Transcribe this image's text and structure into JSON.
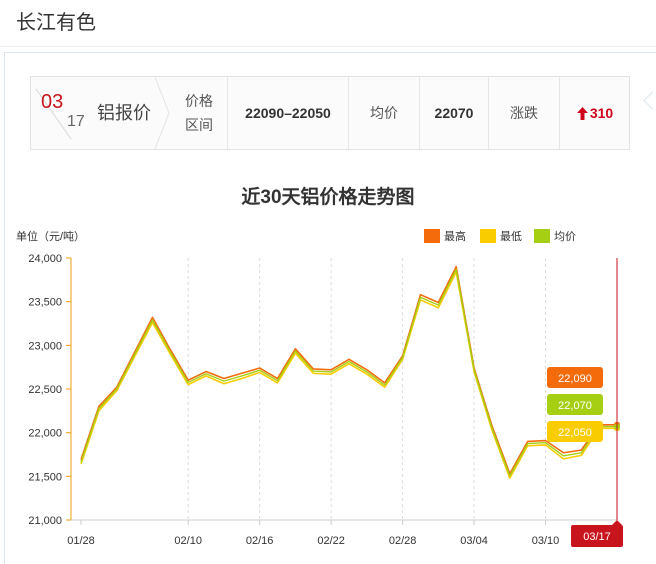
{
  "site": {
    "title": "长江有色"
  },
  "price_bar": {
    "month": "03",
    "day": "17",
    "product": "铝报价",
    "range_label_1": "价格",
    "range_label_2": "区间",
    "range_value": "22090–22050",
    "avg_label": "均价",
    "avg_value": "22070",
    "change_label": "涨跌",
    "change_value": "310",
    "change_direction": "up",
    "colors": {
      "date": "#c8151d",
      "up": "#d0021b"
    }
  },
  "chart_data": {
    "type": "line",
    "title": "近30天铝价格走势图",
    "ylabel": "单位（元/吨）",
    "xlabel": "",
    "ylim": [
      21000,
      24000
    ],
    "y_ticks": [
      "21,000",
      "21,500",
      "22,000",
      "22,500",
      "23,000",
      "23,500",
      "24,000"
    ],
    "x_tick_labels": [
      "01/28",
      "02/10",
      "02/16",
      "02/22",
      "02/28",
      "03/04",
      "03/10",
      "03/17"
    ],
    "x_tick_index": [
      0,
      6,
      10,
      14,
      18,
      22,
      26,
      30
    ],
    "grid": "vertical dashed",
    "legend": "top-right",
    "x": [
      "01/28",
      "01/29",
      "01/30",
      "01/31",
      "02/01",
      "02/09",
      "02/10",
      "02/11",
      "02/12",
      "02/13",
      "02/16",
      "02/17",
      "02/18",
      "02/19",
      "02/22",
      "02/23",
      "02/24",
      "02/25",
      "02/28",
      "03/01",
      "03/02",
      "03/03",
      "03/04",
      "03/07",
      "03/08",
      "03/09",
      "03/10",
      "03/11",
      "03/14",
      "03/15",
      "03/17"
    ],
    "series": [
      {
        "name": "最高",
        "color": "#f36b0b",
        "values": [
          21690,
          22300,
          22520,
          22920,
          23320,
          22950,
          22600,
          22700,
          22620,
          22680,
          22740,
          22620,
          22960,
          22730,
          22720,
          22840,
          22720,
          22570,
          22880,
          23580,
          23490,
          23900,
          22740,
          22080,
          21530,
          21900,
          21910,
          21770,
          21800,
          22090,
          22090
        ]
      },
      {
        "name": "最低",
        "color": "#f9cc00",
        "values": [
          21640,
          22250,
          22480,
          22870,
          23260,
          22900,
          22550,
          22650,
          22560,
          22620,
          22690,
          22570,
          22910,
          22680,
          22670,
          22790,
          22670,
          22520,
          22840,
          23520,
          23430,
          23840,
          22700,
          22030,
          21480,
          21850,
          21860,
          21700,
          21740,
          22050,
          22050
        ]
      },
      {
        "name": "均价",
        "color": "#a6cf13",
        "values": [
          21665,
          22275,
          22500,
          22895,
          23290,
          22925,
          22575,
          22675,
          22590,
          22650,
          22715,
          22595,
          22935,
          22705,
          22695,
          22815,
          22695,
          22545,
          22860,
          23550,
          23460,
          23870,
          22720,
          22055,
          21505,
          21875,
          21885,
          21735,
          21770,
          22070,
          22070
        ]
      }
    ],
    "tooltip_values": [
      "22,090",
      "22,070",
      "22,050"
    ],
    "tooltip_colors": [
      "#f36b0b",
      "#a6cf13",
      "#f9cc00"
    ],
    "current_label": "03/17",
    "current_color": "#c8151d"
  }
}
